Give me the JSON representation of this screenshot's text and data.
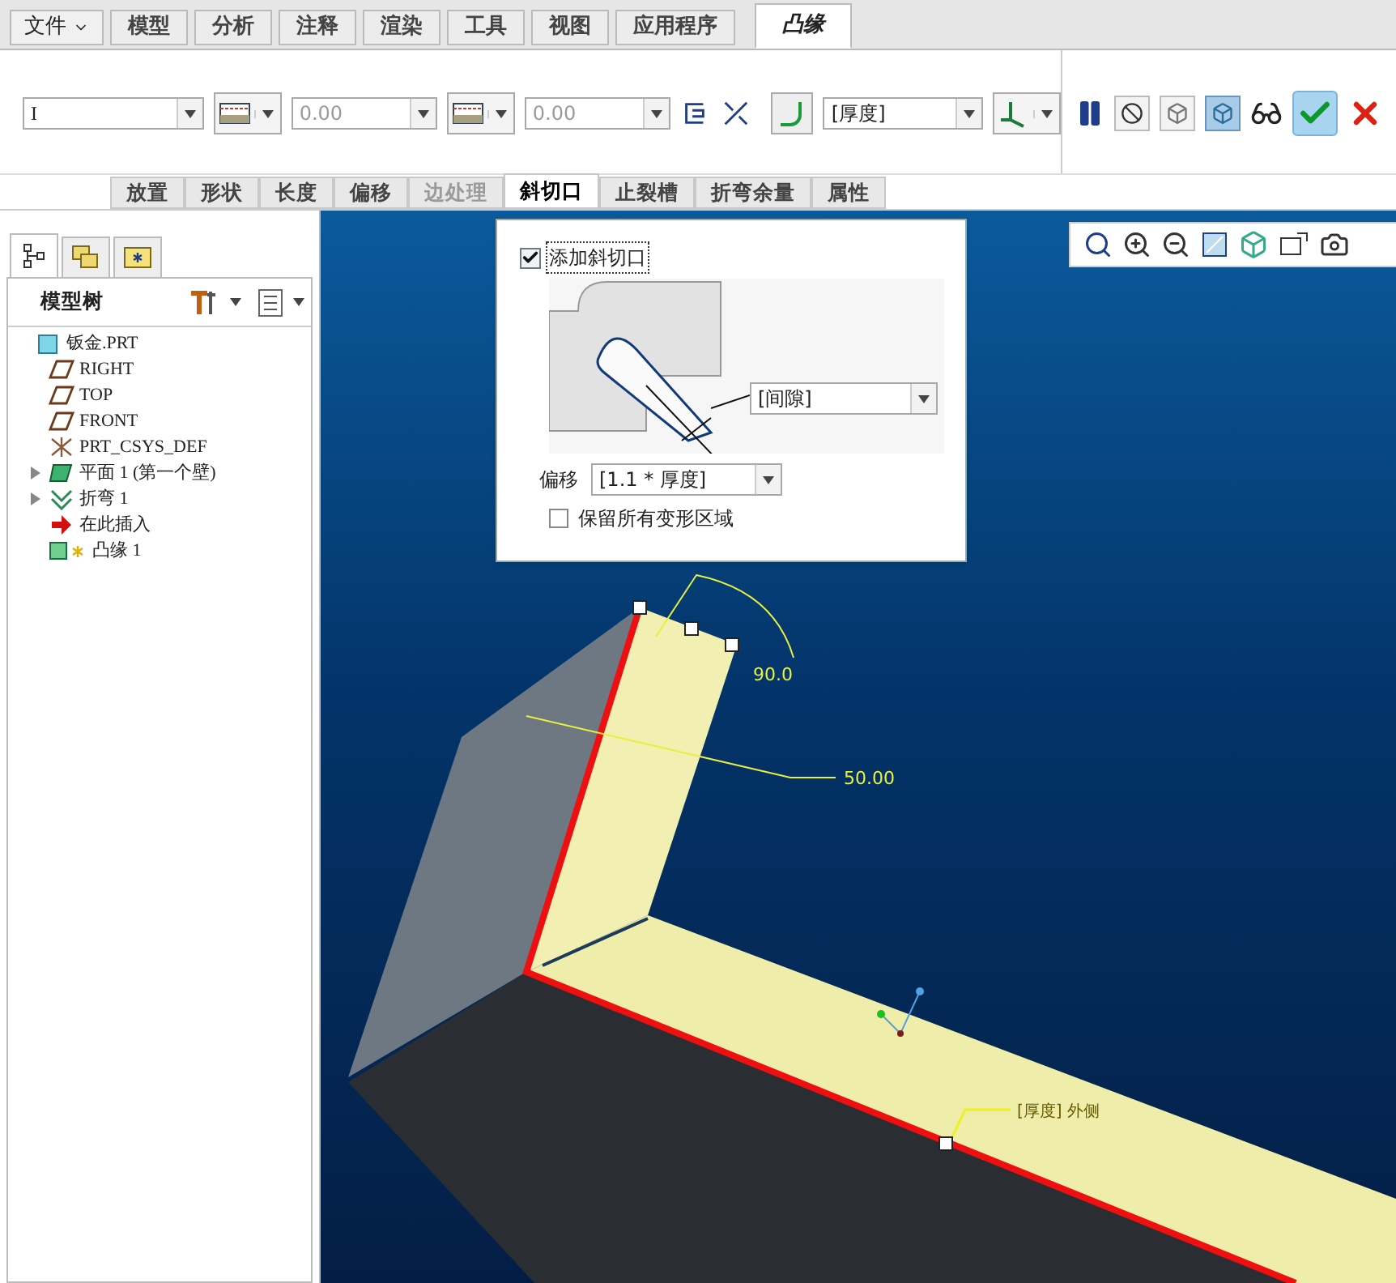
{
  "menu_tabs": [
    {
      "label": "文件",
      "kind": "menu",
      "selected": false
    },
    {
      "label": "模型",
      "kind": "tab",
      "selected": false
    },
    {
      "label": "分析",
      "kind": "tab",
      "selected": false
    },
    {
      "label": "注释",
      "kind": "tab",
      "selected": false
    },
    {
      "label": "渲染",
      "kind": "tab",
      "selected": false
    },
    {
      "label": "工具",
      "kind": "tab",
      "selected": false
    },
    {
      "label": "视图",
      "kind": "tab",
      "selected": false
    },
    {
      "label": "应用程序",
      "kind": "tab",
      "selected": false
    },
    {
      "label": "凸缘",
      "kind": "tab",
      "selected": true
    }
  ],
  "toolbar": {
    "shape_value": "I",
    "length_value_1": "0.00",
    "length_value_2": "0.00",
    "thickness_value": "[厚度]"
  },
  "sub_tabs": [
    {
      "label": "放置",
      "selected": false,
      "disabled": false
    },
    {
      "label": "形状",
      "selected": false,
      "disabled": false
    },
    {
      "label": "长度",
      "selected": false,
      "disabled": false
    },
    {
      "label": "偏移",
      "selected": false,
      "disabled": false
    },
    {
      "label": "边处理",
      "selected": false,
      "disabled": true
    },
    {
      "label": "斜切口",
      "selected": true,
      "disabled": false
    },
    {
      "label": "止裂槽",
      "selected": false,
      "disabled": false
    },
    {
      "label": "折弯余量",
      "selected": false,
      "disabled": false
    },
    {
      "label": "属性",
      "selected": false,
      "disabled": false
    }
  ],
  "model_tree": {
    "title": "模型树",
    "items": [
      {
        "label": "钣金.PRT",
        "kind": "part",
        "collapsed": false
      },
      {
        "label": "RIGHT",
        "kind": "plane",
        "collapsed": false
      },
      {
        "label": "TOP",
        "kind": "plane",
        "collapsed": false
      },
      {
        "label": "FRONT",
        "kind": "plane",
        "collapsed": false
      },
      {
        "label": "PRT_CSYS_DEF",
        "kind": "csys",
        "collapsed": false
      },
      {
        "label": "平面 1 (第一个壁)",
        "kind": "wall",
        "collapsed": true
      },
      {
        "label": "折弯 1",
        "kind": "bend",
        "collapsed": true
      },
      {
        "label": "在此插入",
        "kind": "insert",
        "collapsed": false
      },
      {
        "label": "凸缘 1",
        "kind": "flange",
        "collapsed": false
      }
    ]
  },
  "miter_panel": {
    "add_miter": {
      "label": "添加斜切口",
      "checked": true
    },
    "gap_value": "[间隙]",
    "offset": {
      "label": "偏移",
      "value": "[1.1 * 厚度]"
    },
    "keep_regions": {
      "label": "保留所有变形区域",
      "checked": false
    }
  },
  "viewport": {
    "angle_label": "90.0",
    "length_label": "50.00",
    "side_label": "[厚度] 外侧"
  }
}
